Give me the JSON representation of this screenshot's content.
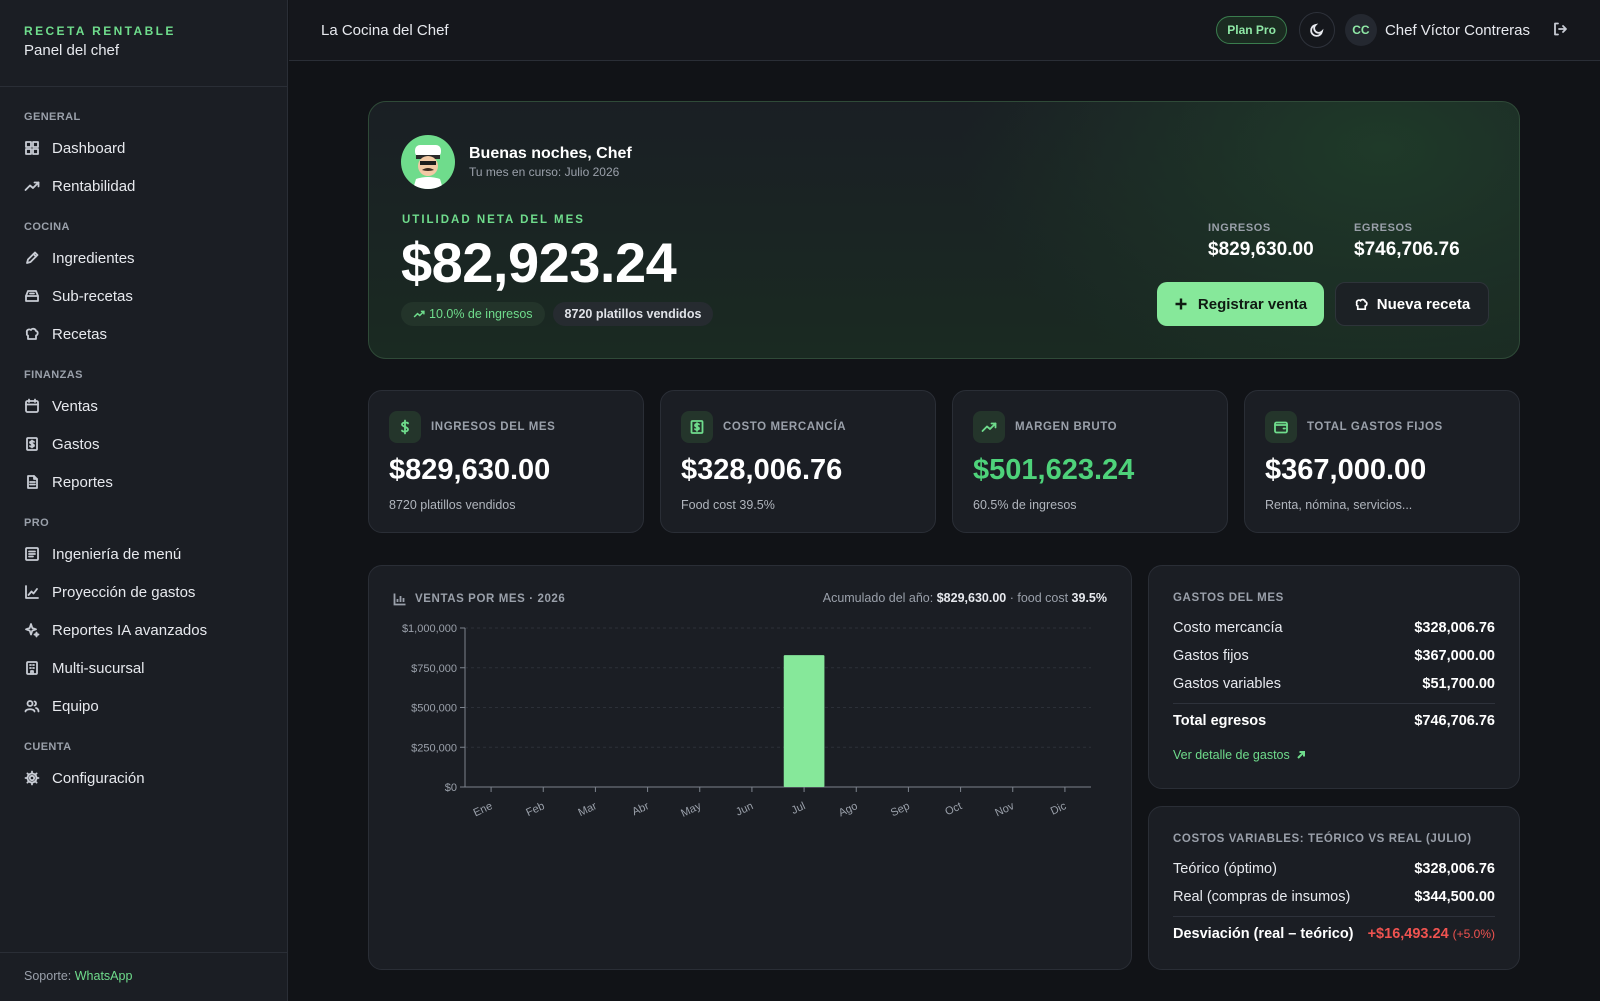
{
  "brand": {
    "name": "RECETA RENTABLE",
    "subtitle": "Panel del chef"
  },
  "nav": {
    "sections": [
      {
        "title": "GENERAL",
        "items": [
          "Dashboard",
          "Rentabilidad"
        ]
      },
      {
        "title": "COCINA",
        "items": [
          "Ingredientes",
          "Sub-recetas",
          "Recetas"
        ]
      },
      {
        "title": "FINANZAS",
        "items": [
          "Ventas",
          "Gastos",
          "Reportes"
        ]
      },
      {
        "title": "PRO",
        "items": [
          "Ingeniería de menú",
          "Proyección de gastos",
          "Reportes IA avanzados",
          "Multi-sucursal",
          "Equipo"
        ]
      },
      {
        "title": "CUENTA",
        "items": [
          "Configuración"
        ]
      }
    ],
    "icons": [
      "grid-icon",
      "trending-up-icon",
      "pen-icon",
      "bowl-icon",
      "chef-hat-icon",
      "calendar-icon",
      "receipt-icon",
      "file-icon",
      "list-icon",
      "line-chart-icon",
      "sparkle-icon",
      "building-icon",
      "users-icon",
      "gear-icon"
    ]
  },
  "support": {
    "label": "Soporte:",
    "link": "WhatsApp"
  },
  "topbar": {
    "title": "La Cocina del Chef",
    "plan": "Plan Pro",
    "initials": "CC",
    "user": "Chef Víctor Contreras"
  },
  "hero": {
    "greeting": "Buenas noches, Chef",
    "month": "Tu mes en curso: Julio 2026",
    "label": "UTILIDAD NETA DEL MES",
    "amount": "$82,923.24",
    "chip_pct": "10.0% de ingresos",
    "chip_count": "8720 platillos vendidos",
    "ingresos_label": "INGRESOS",
    "ingresos_value": "$829,630.00",
    "egresos_label": "EGRESOS",
    "egresos_value": "$746,706.76",
    "btn_register": "Registrar venta",
    "btn_recipe": "Nueva receta"
  },
  "kpis": [
    {
      "label": "INGRESOS DEL MES",
      "value": "$829,630.00",
      "sub": "8720 platillos vendidos",
      "icon": "dollar-icon"
    },
    {
      "label": "COSTO MERCANCÍA",
      "value": "$328,006.76",
      "sub": "Food cost 39.5%",
      "icon": "dollar-square-icon"
    },
    {
      "label": "MARGEN BRUTO",
      "value": "$501,623.24",
      "sub": "60.5% de ingresos",
      "icon": "trending-up-icon"
    },
    {
      "label": "TOTAL GASTOS FIJOS",
      "value": "$367,000.00",
      "sub": "Renta, nómina, servicios...",
      "icon": "wallet-icon"
    }
  ],
  "chart": {
    "title": "VENTAS POR MES · 2026",
    "note_label": "Acumulado del año:",
    "note_total": "$829,630.00",
    "note_mid": " · food cost ",
    "note_pct": "39.5%"
  },
  "chart_data": {
    "type": "bar",
    "title": "VENTAS POR MES · 2026",
    "categories": [
      "Ene",
      "Feb",
      "Mar",
      "Abr",
      "May",
      "Jun",
      "Jul",
      "Ago",
      "Sep",
      "Oct",
      "Nov",
      "Dic"
    ],
    "values": [
      0,
      0,
      0,
      0,
      0,
      0,
      829630,
      0,
      0,
      0,
      0,
      0
    ],
    "ylim": [
      0,
      1000000
    ],
    "yticks": [
      0,
      250000,
      500000,
      750000,
      1000000
    ],
    "ytick_labels": [
      "$0",
      "$250,000",
      "$500,000",
      "$750,000",
      "$1,000,000"
    ],
    "bar_color": "#86e89a",
    "grid": true
  },
  "gastos": {
    "title": "GASTOS DEL MES",
    "rows": [
      {
        "label": "Costo mercancía",
        "value": "$328,006.76"
      },
      {
        "label": "Gastos fijos",
        "value": "$367,000.00"
      },
      {
        "label": "Gastos variables",
        "value": "$51,700.00"
      }
    ],
    "total_label": "Total egresos",
    "total_value": "$746,706.76",
    "link": "Ver detalle de gastos"
  },
  "variables": {
    "title": "COSTOS VARIABLES: TEÓRICO VS REAL (JULIO)",
    "rows": [
      {
        "label": "Teórico (óptimo)",
        "value": "$328,006.76"
      },
      {
        "label": "Real (compras de insumos)",
        "value": "$344,500.00"
      }
    ],
    "dev_label": "Desviación (real – teórico)",
    "dev_value": "+$16,493.24",
    "dev_pct": "(+5.0%)"
  },
  "colors": {
    "accent": "#6fdc8c",
    "bar": "#86e89a",
    "danger": "#ef5350",
    "background": "#111317",
    "card": "#1b1e24"
  }
}
